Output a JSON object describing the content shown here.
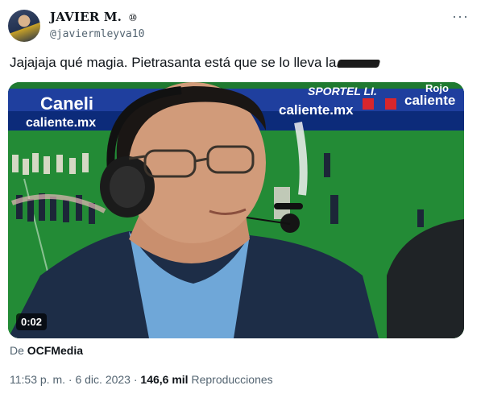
{
  "author": {
    "display_name": "JAVIER M.",
    "badge": "⑩",
    "handle": "@javiermleyva10",
    "avatar_icon": "user-avatar"
  },
  "more_icon": "more-options-icon",
  "tweet": {
    "text": "Jajajaja qué magia. Pietrasanta está que se lo lleva la"
  },
  "media": {
    "duration": "0:02",
    "board_texts": [
      "Caneli",
      "caliente.mx",
      "caliente.mx",
      "SPORTEL LI.",
      "caliente",
      "Rojo"
    ],
    "field_color": "#1c6b2a"
  },
  "source": {
    "prefix": "De",
    "name": "OCFMedia"
  },
  "meta": {
    "time": "11:53 p. m.",
    "sep1": "·",
    "date": "6 dic. 2023",
    "sep2": "·",
    "views": "146,6 mil",
    "views_label": "Reproducciones"
  }
}
